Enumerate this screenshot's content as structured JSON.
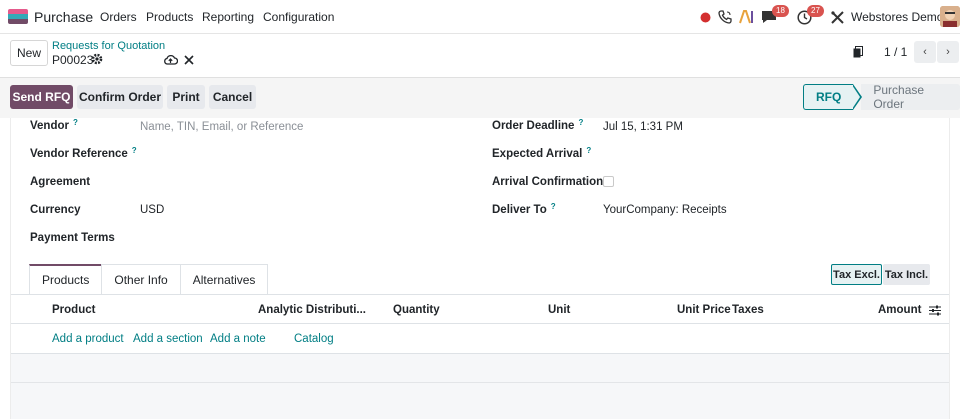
{
  "topbar": {
    "app_name": "Purchase",
    "menu": [
      "Orders",
      "Products",
      "Reporting",
      "Configuration"
    ],
    "messages_count": "18",
    "activities_count": "27",
    "company": "Webstores Demo",
    "icons": [
      "record-dot-icon",
      "phone-icon",
      "ai-icon",
      "chat-icon",
      "clock-icon",
      "tools-icon",
      "avatar"
    ]
  },
  "breadcrumb": {
    "new_label": "New",
    "parent": "Requests for Quotation",
    "current": "P00023",
    "pager": "1 / 1"
  },
  "actions": {
    "send_rfq": "Send RFQ",
    "confirm_order": "Confirm Order",
    "print": "Print",
    "cancel": "Cancel"
  },
  "statusbar": {
    "active": "RFQ",
    "next": "Purchase Order"
  },
  "form": {
    "vendor_label": "Vendor",
    "vendor_placeholder": "Name, TIN, Email, or Reference",
    "vendor_ref_label": "Vendor Reference",
    "agreement_label": "Agreement",
    "currency_label": "Currency",
    "currency_value": "USD",
    "payment_terms_label": "Payment Terms",
    "order_deadline_label": "Order Deadline",
    "order_deadline_value": "Jul 15, 1:31 PM",
    "expected_arrival_label": "Expected Arrival",
    "arrival_confirmation_label": "Arrival Confirmation",
    "deliver_to_label": "Deliver To",
    "deliver_to_value": "YourCompany: Receipts",
    "help_mark": "?"
  },
  "tabs": [
    "Products",
    "Other Info",
    "Alternatives"
  ],
  "tax": {
    "excl": "Tax Excl.",
    "incl": "Tax Incl."
  },
  "table": {
    "columns": [
      "Product",
      "Analytic Distributi...",
      "Quantity",
      "Unit",
      "Unit Price",
      "Taxes",
      "Amount"
    ],
    "add_links": [
      "Add a product",
      "Add a section",
      "Add a note",
      "Catalog"
    ]
  },
  "colors": {
    "brand": "#714b67",
    "link": "#017e84",
    "badge": "#d9534f"
  }
}
